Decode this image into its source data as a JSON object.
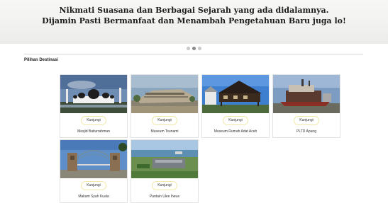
{
  "hero": {
    "line1": "Nikmati Suasana dan Berbagai Sejarah yang ada didalamnya.",
    "line2": "Dijamin Pasti Bermanfaat dan Menambah Pengetahuan Baru juga lo!"
  },
  "carousel": {
    "slide_count": 3,
    "active_index": 1
  },
  "section": {
    "title": "Pilihan Destinasi"
  },
  "destinations": [
    {
      "name": "Mesjid Baiturrahman",
      "button": "Kunjungi"
    },
    {
      "name": "Museum Tsunami",
      "button": "Kunjungi"
    },
    {
      "name": "Museum Rumah Adat Aceh",
      "button": "Kunjungi"
    },
    {
      "name": "PLTD Apung",
      "button": "Kunjungi"
    },
    {
      "name": "Makam Syah Kuala",
      "button": "Kunjungi"
    },
    {
      "name": "Pantain Ulee lheue",
      "button": "Kunjungi"
    }
  ],
  "colors": {
    "button_border": "#f0e7a6",
    "divider": "#d5d5d5"
  }
}
